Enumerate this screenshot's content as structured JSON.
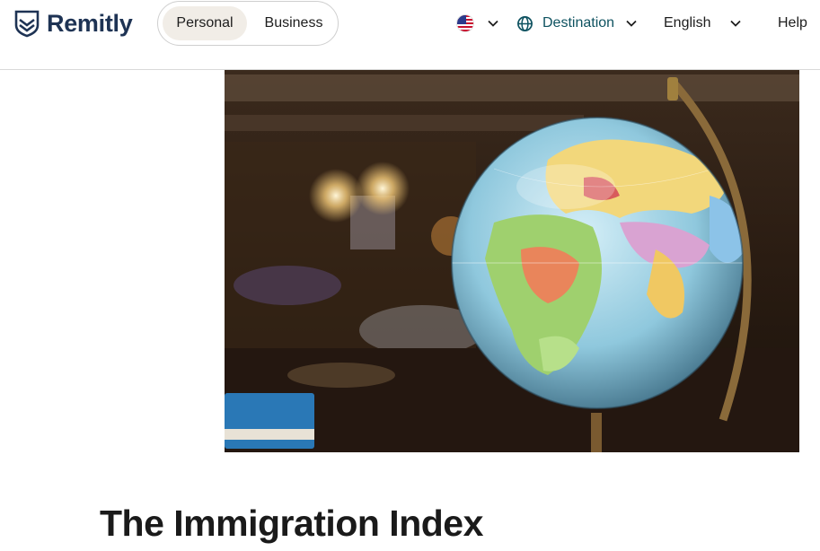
{
  "brand": {
    "name": "Remitly"
  },
  "segment": {
    "personal_label": "Personal",
    "business_label": "Business",
    "selected": "Personal"
  },
  "nav": {
    "country_icon": "us-flag-icon",
    "destination_label": "Destination",
    "language_label": "English",
    "help_label": "Help"
  },
  "hero": {
    "subject": "globe on stand"
  },
  "page": {
    "title": "The Immigration Index"
  },
  "colors": {
    "brand": "#1e3354",
    "destination": "#0e5260",
    "segment_selected": "#f1ede7"
  }
}
